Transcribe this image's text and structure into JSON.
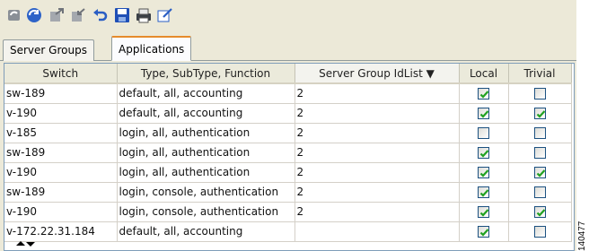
{
  "toolbar": {
    "icons": [
      "refresh-icon",
      "globe-refresh-icon",
      "export-icon",
      "import-icon",
      "undo-icon",
      "save-icon",
      "print-icon",
      "edit-icon"
    ]
  },
  "tabs": [
    {
      "label": "Server Groups",
      "active": false
    },
    {
      "label": "Applications",
      "active": true
    }
  ],
  "table": {
    "columns": [
      "Switch",
      "Type, SubType, Function",
      "Server Group IdList ▼",
      "Local",
      "Trivial"
    ],
    "rows": [
      {
        "switch": "sw-189",
        "function": "default, all, accounting",
        "idlist": "2",
        "local": true,
        "trivial": false
      },
      {
        "switch": "v-190",
        "function": "default, all, accounting",
        "idlist": "2",
        "local": true,
        "trivial": true
      },
      {
        "switch": "v-185",
        "function": "login, all, authentication",
        "idlist": "2",
        "local": false,
        "trivial": false
      },
      {
        "switch": "sw-189",
        "function": "login, all, authentication",
        "idlist": "2",
        "local": true,
        "trivial": false
      },
      {
        "switch": "v-190",
        "function": "login, all, authentication",
        "idlist": "2",
        "local": true,
        "trivial": true
      },
      {
        "switch": "sw-189",
        "function": "login, console, authentication",
        "idlist": "2",
        "local": true,
        "trivial": false
      },
      {
        "switch": "v-190",
        "function": "login, console, authentication",
        "idlist": "2",
        "local": true,
        "trivial": true
      },
      {
        "switch": "v-172.22.31.184",
        "function": "default, all, accounting",
        "idlist": "",
        "local": true,
        "trivial": false
      }
    ]
  },
  "figure_id": "140477",
  "colors": {
    "accent_tab": "#e68b2c",
    "check": "#21a121",
    "panel": "#ece9d8"
  }
}
